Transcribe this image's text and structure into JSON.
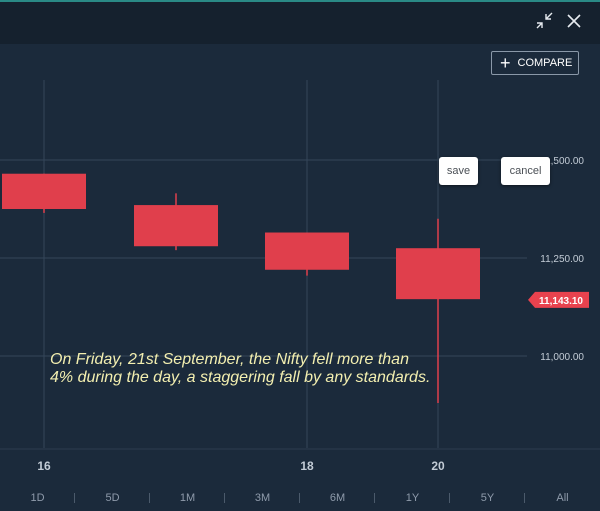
{
  "toolbar": {
    "compare_label": "COMPARE",
    "save_label": "save",
    "cancel_label": "cancel"
  },
  "annotation": {
    "line1": "On Friday, 21st September, the Nifty fell more than",
    "line2": "4% during the day, a staggering fall by any standards."
  },
  "ranges": [
    "1D",
    "5D",
    "1M",
    "3M",
    "6M",
    "1Y",
    "5Y",
    "All"
  ],
  "colors": {
    "background": "#1b2a3b",
    "candle": "#e03f4c",
    "annotation_text": "#f3efb0",
    "price_tag": "#e8424e"
  },
  "chart_data": {
    "type": "candlestick",
    "x_tick_labels": [
      "16",
      "18",
      "20"
    ],
    "y_tick_labels": [
      "11,000.00",
      "11,250.00",
      "11,500.00"
    ],
    "last_price_label": "11,143.10",
    "last_price": 11143.1,
    "candles": [
      {
        "open": 11375,
        "close": 11465,
        "high": 11465,
        "low": 11365
      },
      {
        "open": 11385,
        "close": 11280,
        "high": 11415,
        "low": 11270
      },
      {
        "open": 11315,
        "close": 11220,
        "high": 11315,
        "low": 11205
      },
      {
        "open": 11275,
        "close": 11145,
        "high": 11350,
        "low": 10880
      }
    ],
    "y_gridlines": [
      11000,
      11250,
      11500
    ],
    "grid": true
  }
}
